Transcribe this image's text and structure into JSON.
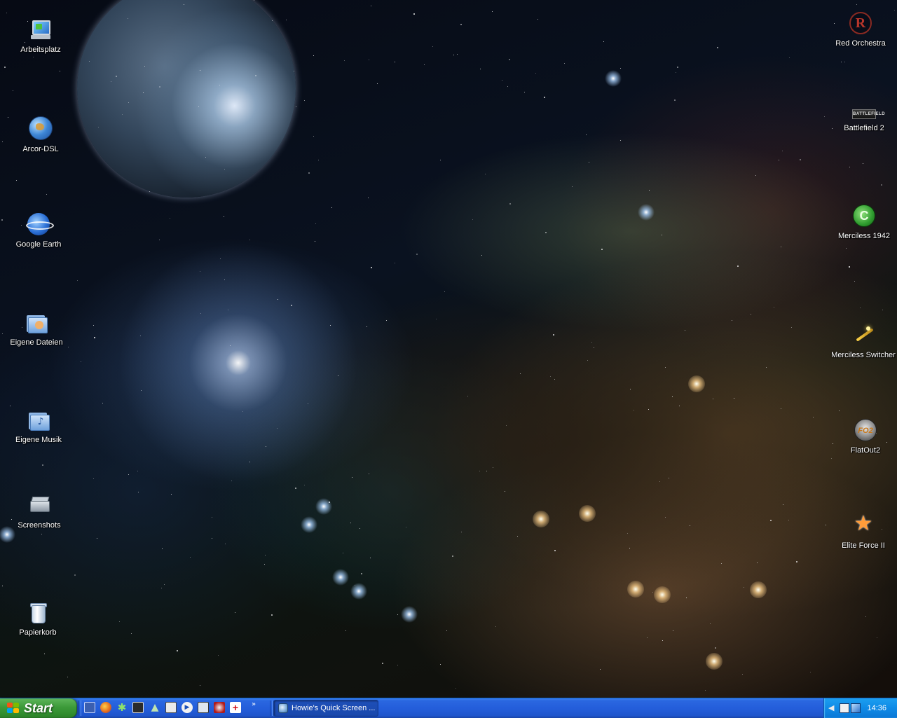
{
  "desktop": {
    "left_icons": [
      {
        "label": "Arbeitsplatz",
        "icon": "my-computer-icon"
      },
      {
        "label": "Arcor-DSL",
        "icon": "internet-globe-icon"
      },
      {
        "label": "Google Earth",
        "icon": "google-earth-icon"
      },
      {
        "label": "Eigene Dateien",
        "icon": "my-documents-icon"
      },
      {
        "label": "Eigene Musik",
        "icon": "my-music-icon"
      },
      {
        "label": "Screenshots",
        "icon": "scanner-icon"
      },
      {
        "label": "Papierkorb",
        "icon": "recycle-bin-icon"
      }
    ],
    "right_icons": [
      {
        "label": "Red Orchestra",
        "icon": "red-orchestra-icon",
        "glyph": "R"
      },
      {
        "label": "Battlefield 2",
        "icon": "battlefield-icon",
        "glyph": "BATTLEFIELD"
      },
      {
        "label": "Merciless 1942",
        "icon": "merciless-icon",
        "glyph": "C"
      },
      {
        "label": "Merciless Switcher",
        "icon": "magic-wand-icon"
      },
      {
        "label": "FlatOut2",
        "icon": "flatout-icon",
        "glyph": "FO2"
      },
      {
        "label": "Elite Force II",
        "icon": "star-trek-icon",
        "glyph": "★"
      }
    ]
  },
  "taskbar": {
    "start_label": "Start",
    "quick_launch": [
      "launcher-icon",
      "firefox-icon",
      "settings-gear-icon",
      "media-icon",
      "triangle-app-icon",
      "chat-icon",
      "play-icon",
      "program-icon",
      "game-icon",
      "plus-icon"
    ],
    "overflow_glyph": "»",
    "task_button_label": "Howie's Quick Screen ...",
    "tray_icons": [
      "volume-icon",
      "network-icon",
      "monitor-icon"
    ],
    "clock": "14:36"
  },
  "colors": {
    "taskbar": "#245edb",
    "start_button": "#3c9a39",
    "tray": "#0f8ae6"
  }
}
